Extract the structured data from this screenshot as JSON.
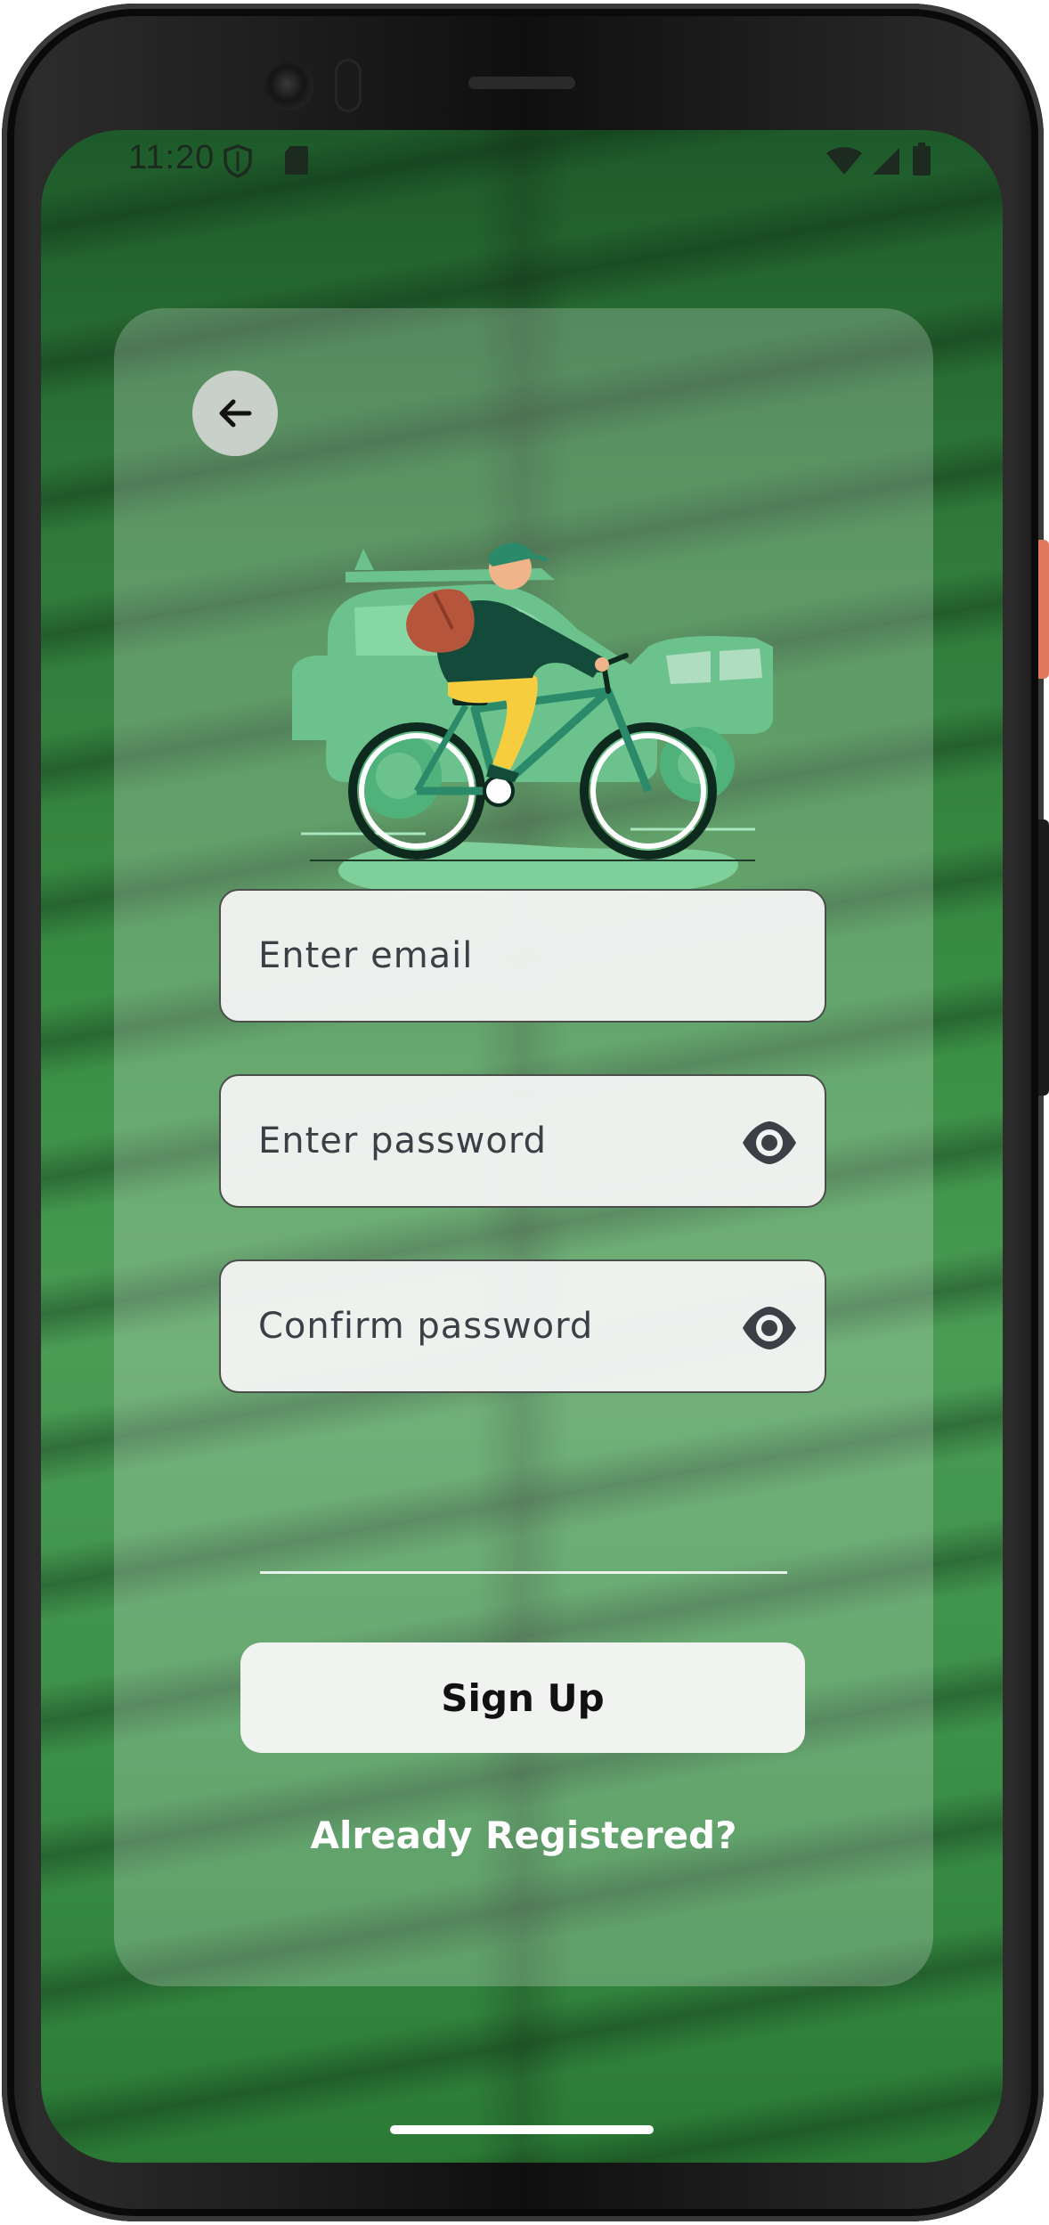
{
  "status_bar": {
    "time": "11:20",
    "left_icons": [
      "shield-icon",
      "sd-card-icon"
    ],
    "right_icons": [
      "wifi-icon",
      "signal-icon",
      "battery-icon"
    ]
  },
  "form": {
    "email_placeholder": "Enter email",
    "password_placeholder": "Enter password",
    "confirm_placeholder": "Confirm password",
    "signup_label": "Sign Up",
    "already_registered_label": "Already Registered?"
  },
  "icons": {
    "back": "arrow-left-icon",
    "password_toggle": "eye-icon",
    "confirm_toggle": "eye-icon"
  },
  "colors": {
    "background_green": "#3a8f45",
    "card_overlay": "#ffffff",
    "field_border": "#4a4f4a",
    "button_bg": "#f1f3f1"
  }
}
